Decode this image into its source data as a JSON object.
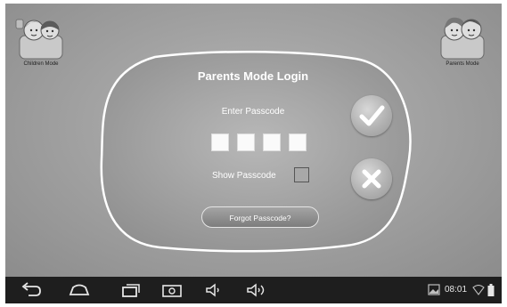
{
  "app": {
    "children_mode_label": "Children Mode",
    "parents_mode_label": "Parents Mode"
  },
  "dialog": {
    "title": "Parents Mode Login",
    "enter_label": "Enter Passcode",
    "passcode_digits": [
      "",
      "",
      "",
      ""
    ],
    "show_passcode_label": "Show Passcode",
    "show_passcode_checked": false,
    "forgot_label": "Forgot Passcode?"
  },
  "actions": {
    "confirm_icon": "checkmark-icon",
    "cancel_icon": "x-icon"
  },
  "navbar": {
    "icons": [
      "back-icon",
      "home-icon",
      "recent-apps-icon",
      "screenshot-icon",
      "volume-down-icon",
      "volume-up-icon"
    ]
  },
  "status": {
    "time": "08:01",
    "icons": [
      "gallery-notification-icon",
      "wifi-icon",
      "battery-icon"
    ]
  },
  "colors": {
    "background": "#a3a3a3",
    "navbar": "#1e1e1e",
    "text": "#ffffff"
  }
}
